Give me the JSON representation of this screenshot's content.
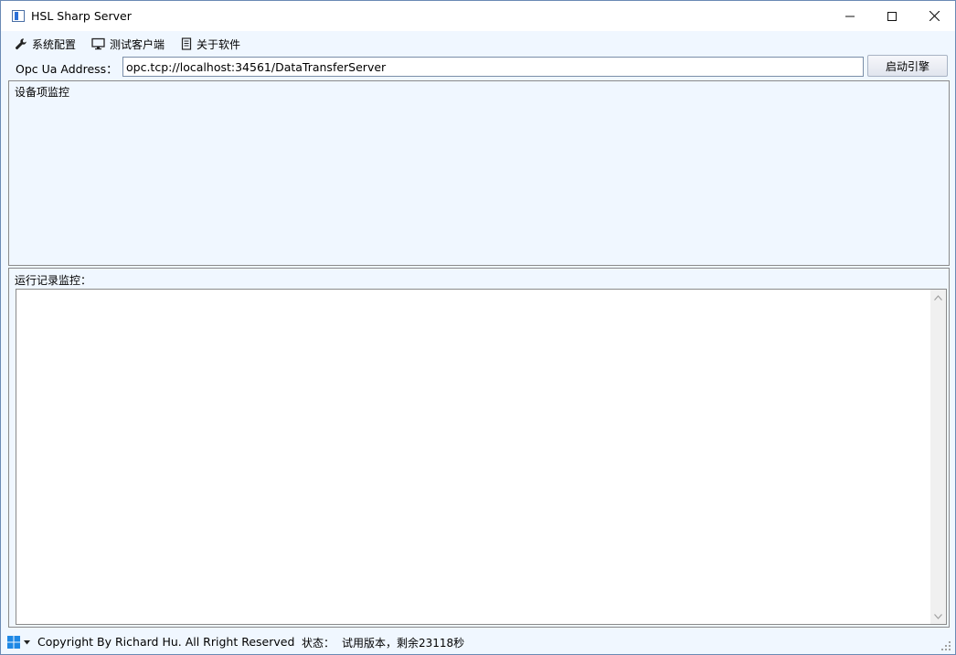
{
  "window": {
    "title": "HSL Sharp Server"
  },
  "menu": {
    "items": [
      {
        "label": "系统配置",
        "icon": "wrench-icon"
      },
      {
        "label": "测试客户端",
        "icon": "monitor-icon"
      },
      {
        "label": "关于软件",
        "icon": "document-icon"
      }
    ]
  },
  "address": {
    "label": "Opc Ua Address：",
    "value": "opc.tcp://localhost:34561/DataTransferServer",
    "start_button": "启动引擎"
  },
  "device_panel": {
    "title": "设备项监控"
  },
  "log_panel": {
    "title": "运行记录监控："
  },
  "status": {
    "copyright": "Copyright By Richard Hu. All Rright Reserved",
    "state_label": "状态：",
    "state_value": "试用版本，剩余23118秒"
  },
  "colors": {
    "accent": "#2b6fd6",
    "client_bg": "#f0f7ff",
    "border": "#8a8a8a"
  }
}
